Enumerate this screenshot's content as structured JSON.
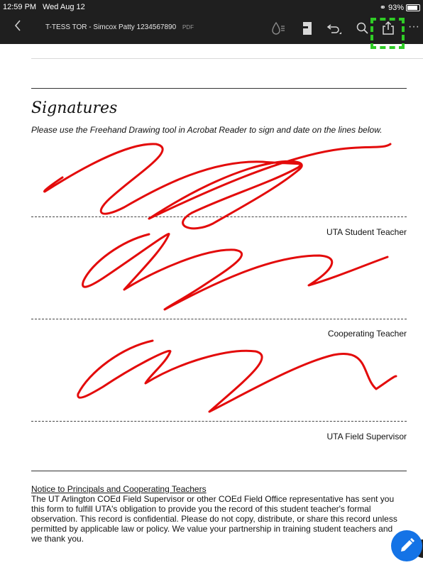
{
  "status_bar": {
    "time": "12:59 PM",
    "date": "Wed Aug 12",
    "battery": "93%"
  },
  "toolbar": {
    "title": "T-TESS TOR - Simcox Patty 1234567890",
    "doc_type": "PDF",
    "more": "···",
    "icons": [
      "back-icon",
      "redact-icon",
      "bookmark-icon",
      "undo-icon",
      "search-icon",
      "share-icon",
      "more-icon"
    ]
  },
  "document": {
    "heading": "Signatures",
    "instructions": "Please use the Freehand Drawing tool in Acrobat Reader to sign and date on the lines below.",
    "signature_labels": {
      "student": "UTA Student Teacher",
      "cooperating": "Cooperating Teacher",
      "field": "UTA Field Supervisor"
    },
    "notice": {
      "heading": "Notice to Principals and Cooperating Teachers",
      "body": "The UT Arlington COEd Field Supervisor or other COEd Field Office representative has sent you this form to fulfill UTA's obligation to provide you the record of this student teacher's formal observation. This record is confidential. Please do not copy, distribute, or share this record unless permitted by applicable law or policy. We value your partnership in training student teachers and we thank you."
    }
  },
  "colors": {
    "toolbar_bg": "#1f1f1f",
    "ink": "#e30b0b",
    "highlight": "#2fcc26",
    "fab": "#1473e6"
  }
}
